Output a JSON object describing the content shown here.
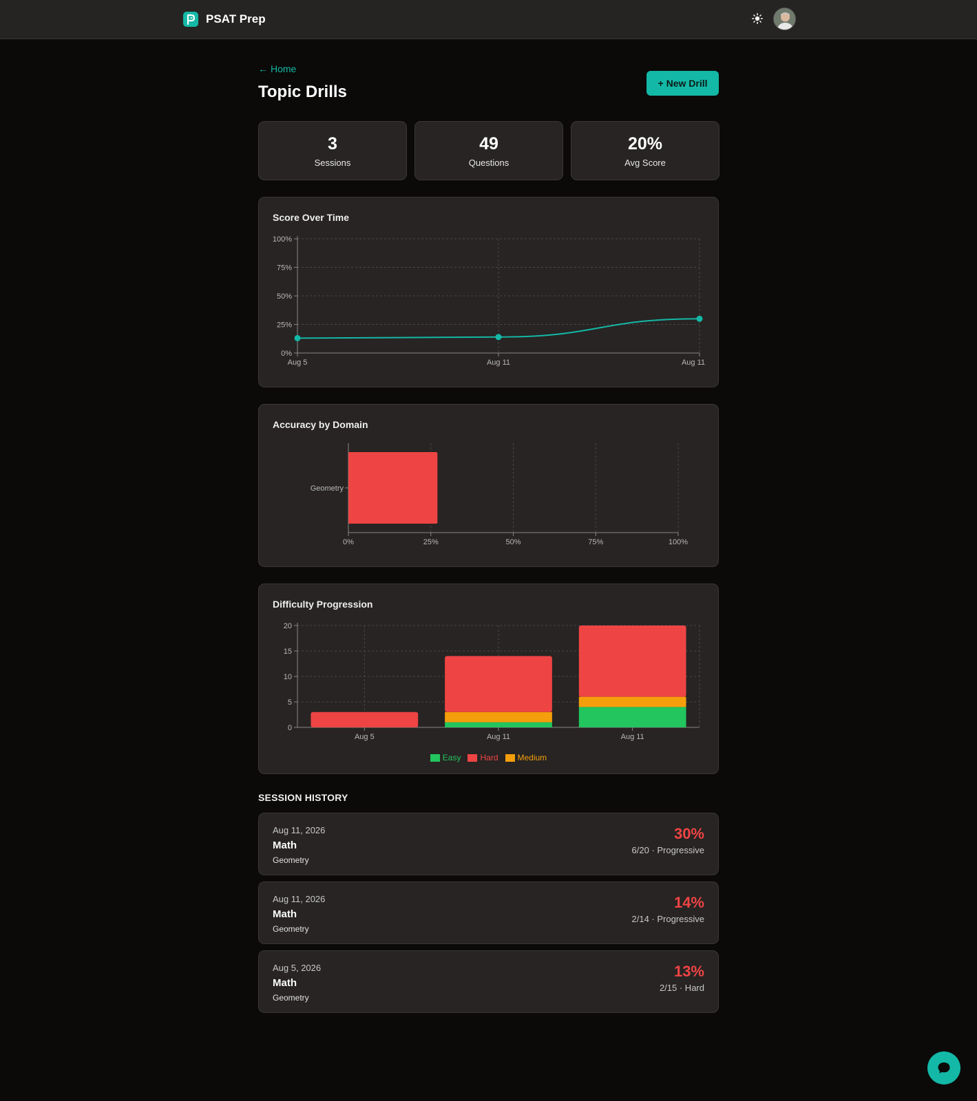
{
  "header": {
    "brand_name": "PSAT Prep",
    "theme_icon": "sun-icon",
    "avatar_icon": "user-avatar"
  },
  "nav": {
    "back_label": "Home",
    "back_icon": "arrow-left-icon"
  },
  "page": {
    "title": "Topic Drills",
    "new_drill_label": "+ New Drill"
  },
  "stats": [
    {
      "value": "3",
      "label": "Sessions"
    },
    {
      "value": "49",
      "label": "Questions"
    },
    {
      "value": "20%",
      "label": "Avg Score"
    }
  ],
  "colors": {
    "accent": "#14b8a6",
    "easy": "#22c55e",
    "medium": "#f59e0b",
    "hard": "#ef4444"
  },
  "chart_data": [
    {
      "type": "line",
      "title": "Score Over Time",
      "x": [
        "Aug 5",
        "Aug 11",
        "Aug 11"
      ],
      "y": [
        13,
        14,
        30
      ],
      "yticks": [
        "0%",
        "25%",
        "50%",
        "75%",
        "100%"
      ],
      "ylim": [
        0,
        100
      ],
      "grid": true
    },
    {
      "type": "bar",
      "orientation": "horizontal",
      "title": "Accuracy by Domain",
      "categories": [
        "Geometry"
      ],
      "values": [
        27
      ],
      "xticks": [
        "0%",
        "25%",
        "50%",
        "75%",
        "100%"
      ],
      "xlim": [
        0,
        100
      ],
      "grid": true
    },
    {
      "type": "bar",
      "stacked": true,
      "title": "Difficulty Progression",
      "categories": [
        "Aug 5",
        "Aug 11",
        "Aug 11"
      ],
      "series": [
        {
          "name": "Easy",
          "values": [
            0,
            1,
            4
          ]
        },
        {
          "name": "Medium",
          "values": [
            0,
            2,
            2
          ]
        },
        {
          "name": "Hard",
          "values": [
            3,
            11,
            14
          ]
        }
      ],
      "yticks": [
        "0",
        "5",
        "10",
        "15",
        "20"
      ],
      "ylim": [
        0,
        20
      ],
      "legend": [
        "Easy",
        "Hard",
        "Medium"
      ],
      "legend_position": "bottom",
      "grid": true
    }
  ],
  "history": {
    "title": "SESSION HISTORY",
    "sessions": [
      {
        "date": "Aug 11, 2026",
        "subject": "Math",
        "domain": "Geometry",
        "score": "30%",
        "meta": "6/20 · Progressive"
      },
      {
        "date": "Aug 11, 2026",
        "subject": "Math",
        "domain": "Geometry",
        "score": "14%",
        "meta": "2/14 · Progressive"
      },
      {
        "date": "Aug 5, 2026",
        "subject": "Math",
        "domain": "Geometry",
        "score": "13%",
        "meta": "2/15 · Hard"
      }
    ]
  },
  "chat": {
    "icon": "chat-bubble-icon"
  }
}
